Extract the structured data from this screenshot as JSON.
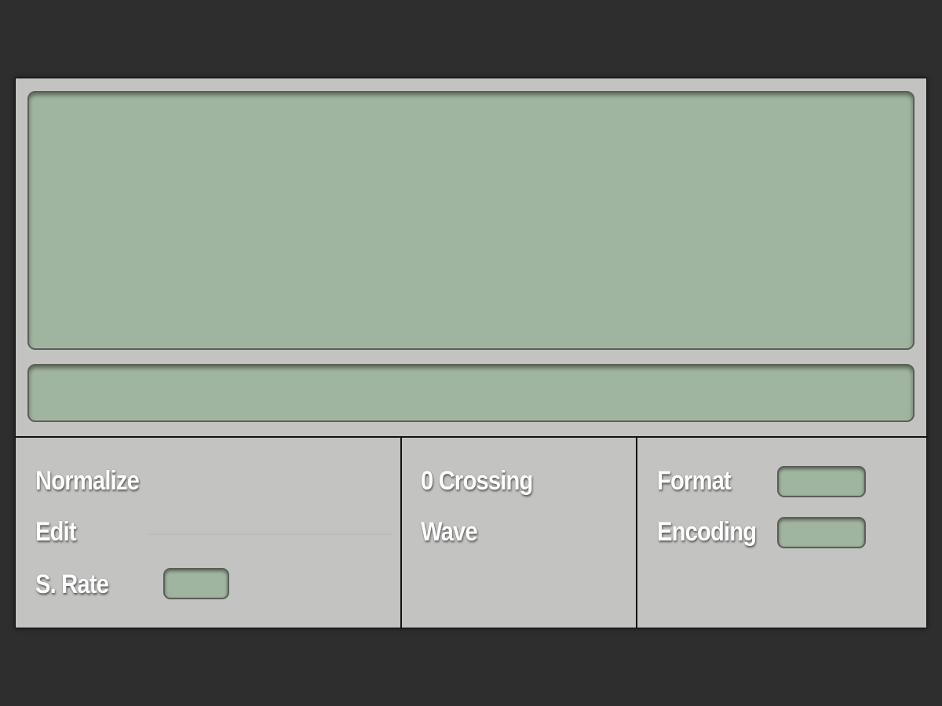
{
  "lcd": {
    "main_text": "",
    "status_text": ""
  },
  "controls": {
    "section1": {
      "normalize_label": "Normalize",
      "edit_label": "Edit",
      "sample_rate_label": "S. Rate",
      "sample_rate_value": ""
    },
    "section2": {
      "zero_crossing_label": "0 Crossing",
      "wave_label": "Wave"
    },
    "section3": {
      "format_label": "Format",
      "format_value": "",
      "encoding_label": "Encoding",
      "encoding_value": ""
    }
  },
  "colors": {
    "background": "#2e2e2e",
    "panel": "#c3c3c1",
    "lcd": "#a0b59f",
    "label": "#ffffff"
  }
}
